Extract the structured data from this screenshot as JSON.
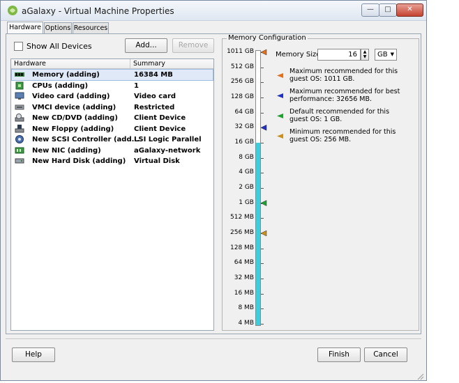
{
  "window": {
    "title": "aGalaxy - Virtual Machine Properties",
    "controls": {
      "minimize": "—",
      "maximize": "□",
      "close": "✕"
    }
  },
  "tabs": [
    {
      "label": "Hardware",
      "active": true
    },
    {
      "label": "Options",
      "active": false
    },
    {
      "label": "Resources",
      "active": false
    }
  ],
  "toolbar": {
    "show_all_devices_label": "Show All Devices",
    "show_all_devices_checked": false,
    "add_label": "Add...",
    "remove_label": "Remove"
  },
  "hardware_list": {
    "columns": [
      "Hardware",
      "Summary"
    ],
    "rows": [
      {
        "icon": "memory-icon",
        "name": "Memory (adding)",
        "summary": "16384 MB",
        "selected": true
      },
      {
        "icon": "cpu-icon",
        "name": "CPUs (adding)",
        "summary": "1",
        "selected": false
      },
      {
        "icon": "monitor-icon",
        "name": "Video card  (adding)",
        "summary": "Video card",
        "selected": false
      },
      {
        "icon": "vmci-icon",
        "name": "VMCI device (adding)",
        "summary": "Restricted",
        "selected": false
      },
      {
        "icon": "cd-dvd-icon",
        "name": "New CD/DVD (adding)",
        "summary": "Client Device",
        "selected": false
      },
      {
        "icon": "floppy-icon",
        "name": "New Floppy (adding)",
        "summary": "Client Device",
        "selected": false
      },
      {
        "icon": "scsi-icon",
        "name": "New SCSI Controller (add...",
        "summary": "LSI Logic Parallel",
        "selected": false
      },
      {
        "icon": "nic-icon",
        "name": "New NIC (adding)",
        "summary": "aGalaxy-network",
        "selected": false
      },
      {
        "icon": "hard-disk-icon",
        "name": "New Hard Disk (adding)",
        "summary": "Virtual Disk",
        "selected": false
      }
    ]
  },
  "memory_config": {
    "group_label": "Memory Configuration",
    "memory_size_label": "Memory Size:",
    "memory_size_value": "16",
    "unit": "GB",
    "scale_labels": [
      "1011 GB",
      "512 GB",
      "256 GB",
      "128 GB",
      "64 GB",
      "32 GB",
      "16 GB",
      "8 GB",
      "4 GB",
      "2 GB",
      "1 GB",
      "512 MB",
      "256 MB",
      "128 MB",
      "64 MB",
      "32 MB",
      "16 MB",
      "8 MB",
      "4 MB"
    ],
    "slider_level_label": "16 GB",
    "legend": [
      {
        "color": "#e07020",
        "text": "Maximum recommended for this guest OS: 1011 GB."
      },
      {
        "color": "#2030c0",
        "text": "Maximum recommended for best performance: 32656 MB."
      },
      {
        "color": "#20a030",
        "text": "Default recommended for this guest OS: 1 GB."
      },
      {
        "color": "#c89020",
        "text": "Minimum recommended for this guest OS: 256 MB."
      }
    ],
    "markers": [
      {
        "level": "1011 GB",
        "color": "#e07020"
      },
      {
        "level": "32 GB",
        "color": "#2030c0"
      },
      {
        "level": "1 GB",
        "color": "#20a030"
      },
      {
        "level": "256 MB",
        "color": "#c89020"
      }
    ],
    "colors": {
      "fill": "#38d0e0"
    }
  },
  "footer": {
    "help_label": "Help",
    "finish_label": "Finish",
    "cancel_label": "Cancel"
  }
}
